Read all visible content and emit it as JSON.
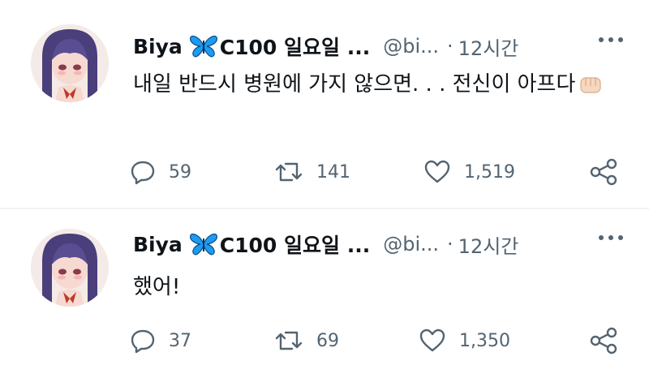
{
  "tweets": [
    {
      "author": {
        "name": "Biya",
        "name_suffix": "C100 일요일 ...",
        "handle": "@bi...",
        "avatar": "avatar-anime-girl-purple-hair",
        "badge_icon": "butterfly-icon"
      },
      "separator": "·",
      "time": "12시간",
      "text": "내일 반드시 병원에 가지 않으면. . . 전신이 아프다",
      "emoji": "fist-emoji",
      "actions": {
        "replies": "59",
        "retweets": "141",
        "likes": "1,519"
      }
    },
    {
      "author": {
        "name": "Biya",
        "name_suffix": "C100 일요일 ...",
        "handle": "@bi...",
        "avatar": "avatar-anime-girl-purple-hair",
        "badge_icon": "butterfly-icon"
      },
      "separator": "·",
      "time": "12시간",
      "text": "했어!",
      "emoji": "",
      "actions": {
        "replies": "37",
        "retweets": "69",
        "likes": "1,350"
      }
    }
  ],
  "colors": {
    "text_primary": "#0f1419",
    "text_secondary": "#536471",
    "divider": "#eff3f4",
    "butterfly": "#1d9bf0"
  }
}
